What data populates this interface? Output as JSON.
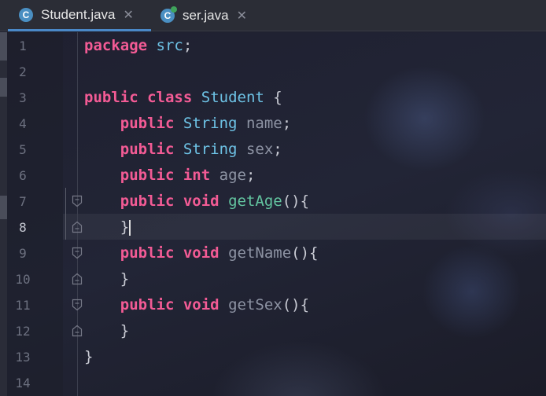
{
  "tabs": [
    {
      "label": "Student.java",
      "icon": "class-file-icon",
      "icon_letter": "C",
      "active": true
    },
    {
      "label": "ser.java",
      "icon": "runnable-class-file-icon",
      "icon_letter": "C",
      "active": false
    }
  ],
  "close_glyph": "✕",
  "current_line": 8,
  "fold_lines": [
    7,
    8,
    9,
    10,
    11,
    12
  ],
  "lines": [
    {
      "number": "1",
      "tokens": [
        {
          "t": "package",
          "c": "kw"
        },
        {
          "t": " ",
          "c": "pl"
        },
        {
          "t": "src",
          "c": "ty"
        },
        {
          "t": ";",
          "c": "pl"
        }
      ]
    },
    {
      "number": "2",
      "tokens": []
    },
    {
      "number": "3",
      "tokens": [
        {
          "t": "public",
          "c": "kw"
        },
        {
          "t": " ",
          "c": "pl"
        },
        {
          "t": "class",
          "c": "kw"
        },
        {
          "t": " ",
          "c": "pl"
        },
        {
          "t": "Student",
          "c": "ty"
        },
        {
          "t": " {",
          "c": "pl"
        }
      ]
    },
    {
      "number": "4",
      "tokens": [
        {
          "t": "    ",
          "c": "pl"
        },
        {
          "t": "public",
          "c": "kw"
        },
        {
          "t": " ",
          "c": "pl"
        },
        {
          "t": "String",
          "c": "ty"
        },
        {
          "t": " ",
          "c": "pl"
        },
        {
          "t": "name",
          "c": "va"
        },
        {
          "t": ";",
          "c": "pl"
        }
      ]
    },
    {
      "number": "5",
      "tokens": [
        {
          "t": "    ",
          "c": "pl"
        },
        {
          "t": "public",
          "c": "kw"
        },
        {
          "t": " ",
          "c": "pl"
        },
        {
          "t": "String",
          "c": "ty"
        },
        {
          "t": " ",
          "c": "pl"
        },
        {
          "t": "sex",
          "c": "va"
        },
        {
          "t": ";",
          "c": "pl"
        }
      ]
    },
    {
      "number": "6",
      "tokens": [
        {
          "t": "    ",
          "c": "pl"
        },
        {
          "t": "public",
          "c": "kw"
        },
        {
          "t": " ",
          "c": "pl"
        },
        {
          "t": "int",
          "c": "kw"
        },
        {
          "t": " ",
          "c": "pl"
        },
        {
          "t": "age",
          "c": "va"
        },
        {
          "t": ";",
          "c": "pl"
        }
      ]
    },
    {
      "number": "7",
      "tokens": [
        {
          "t": "    ",
          "c": "pl"
        },
        {
          "t": "public",
          "c": "kw"
        },
        {
          "t": " ",
          "c": "pl"
        },
        {
          "t": "void",
          "c": "kw"
        },
        {
          "t": " ",
          "c": "pl"
        },
        {
          "t": "getAge",
          "c": "fn"
        },
        {
          "t": "(){",
          "c": "pl"
        }
      ]
    },
    {
      "number": "8",
      "tokens": [
        {
          "t": "    ",
          "c": "pl"
        },
        {
          "t": "}",
          "c": "pl"
        }
      ]
    },
    {
      "number": "9",
      "tokens": [
        {
          "t": "    ",
          "c": "pl"
        },
        {
          "t": "public",
          "c": "kw"
        },
        {
          "t": " ",
          "c": "pl"
        },
        {
          "t": "void",
          "c": "kw"
        },
        {
          "t": " ",
          "c": "pl"
        },
        {
          "t": "getName",
          "c": "va"
        },
        {
          "t": "(){",
          "c": "pl"
        }
      ]
    },
    {
      "number": "10",
      "tokens": [
        {
          "t": "    ",
          "c": "pl"
        },
        {
          "t": "}",
          "c": "pl"
        }
      ]
    },
    {
      "number": "11",
      "tokens": [
        {
          "t": "    ",
          "c": "pl"
        },
        {
          "t": "public",
          "c": "kw"
        },
        {
          "t": " ",
          "c": "pl"
        },
        {
          "t": "void",
          "c": "kw"
        },
        {
          "t": " ",
          "c": "pl"
        },
        {
          "t": "getSex",
          "c": "va"
        },
        {
          "t": "(){",
          "c": "pl"
        }
      ]
    },
    {
      "number": "12",
      "tokens": [
        {
          "t": "    ",
          "c": "pl"
        },
        {
          "t": "}",
          "c": "pl"
        }
      ]
    },
    {
      "number": "13",
      "tokens": [
        {
          "t": "}",
          "c": "pl"
        }
      ]
    },
    {
      "number": "14",
      "tokens": []
    }
  ]
}
